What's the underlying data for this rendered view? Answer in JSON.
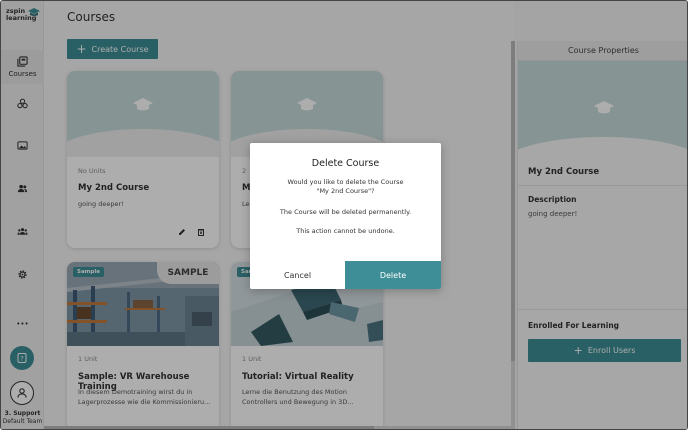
{
  "brand": {
    "line1": "zspin",
    "line2": "learning"
  },
  "sidebar": {
    "items": [
      {
        "label": "Courses"
      }
    ],
    "more": "•••",
    "help": "?",
    "user": {
      "name": "3. Support",
      "team": "Default Team"
    }
  },
  "main": {
    "title": "Courses",
    "create_button": "Create Course",
    "cards": [
      {
        "meta": "No Units",
        "title": "My 2nd Course",
        "description": "going deeper!"
      },
      {
        "meta": "2",
        "title": "M",
        "description": "Le"
      },
      {
        "badge": "Sample",
        "ribbon": "SAMPLE",
        "meta": "1 Unit",
        "title": "Sample: VR Warehouse Training",
        "description": "In diesem Demotraining wirst du in Lagerprozesse wie die Kommissionieru..."
      },
      {
        "badge": "Sample",
        "meta": "1 Unit",
        "title": "Tutorial: Virtual Reality",
        "description": "Lerne die Benutzung des Motion Controllers und Bewegung in 3D..."
      }
    ]
  },
  "properties": {
    "header": "Course Properties",
    "name": "My 2nd Course",
    "description_label": "Description",
    "description": "going deeper!",
    "enrolled_label": "Enrolled For Learning",
    "enroll_button": "Enroll Users"
  },
  "dialog": {
    "title": "Delete Course",
    "line1": "Would you like to delete the Course",
    "line2": "\"My 2nd Course\"?",
    "line3": "The Course will be deleted permanently.",
    "line4": "This action cannot be undone.",
    "cancel": "Cancel",
    "confirm": "Delete"
  },
  "colors": {
    "accent": "#3d8e96",
    "hero": "#c6dadb"
  }
}
